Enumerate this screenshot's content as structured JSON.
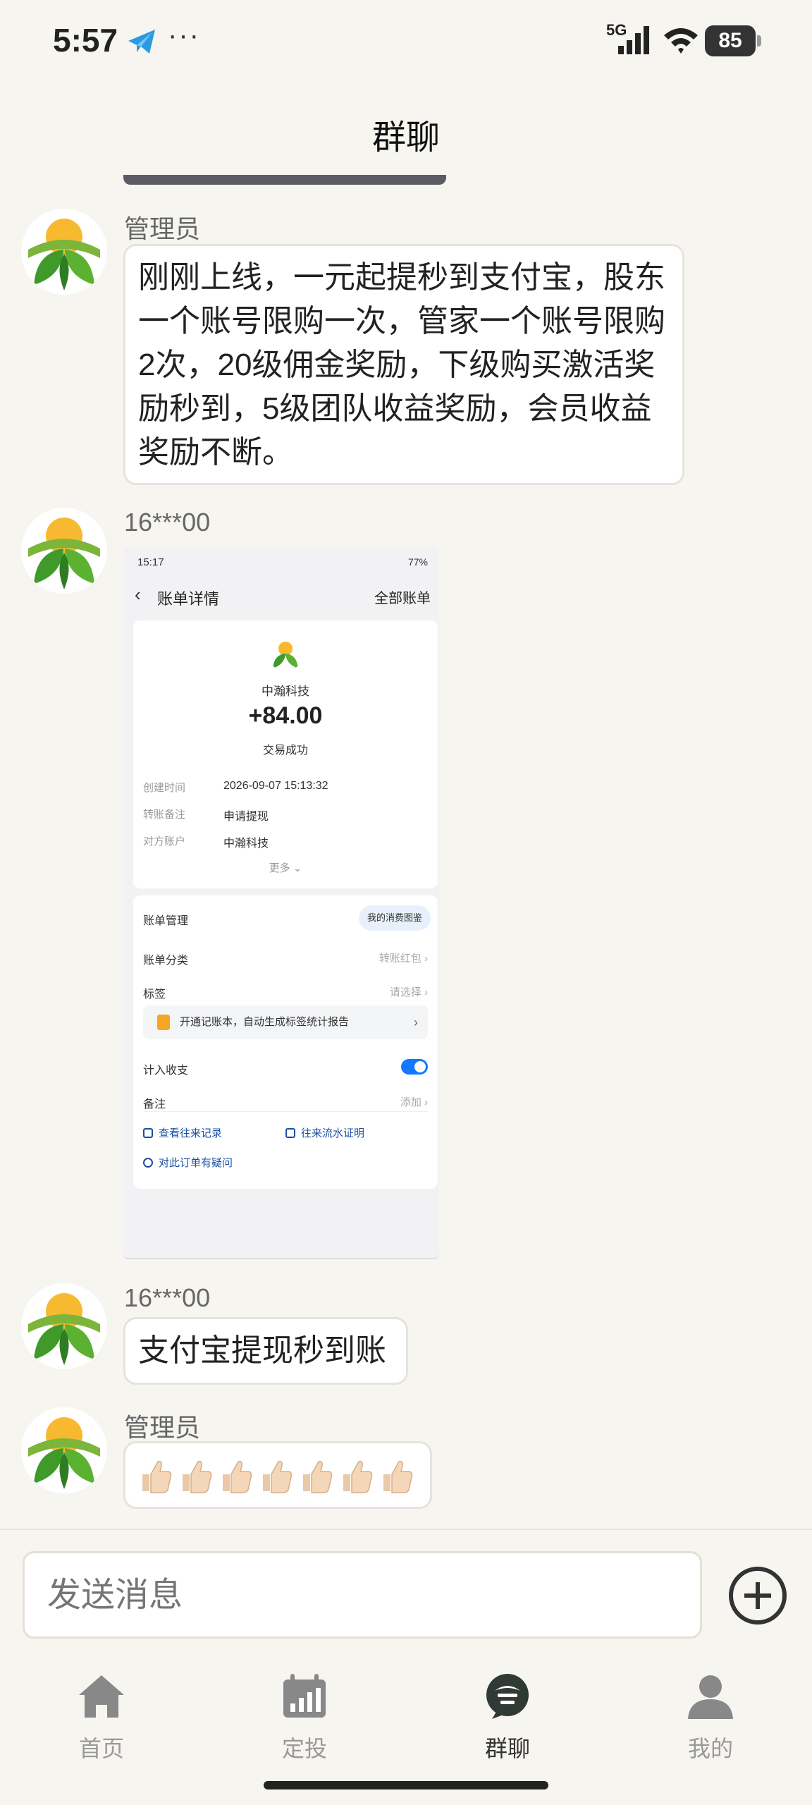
{
  "status_bar": {
    "time": "5:57",
    "more": "···",
    "network": "5G",
    "battery": "85"
  },
  "header": {
    "title": "群聊"
  },
  "messages": [
    {
      "sender": "管理员",
      "text": "刚刚上线，一元起提秒到支付宝，股东一个账号限购一次，管家一个账号限购2次，20级佣金奖励，下级购买激活奖励秒到，5级团队收益奖励，会员收益奖励不断。"
    },
    {
      "sender": "16***00",
      "image": {
        "status_time": "15:17",
        "status_battery": "77%",
        "title": "账单详情",
        "all_bills": "全部账单",
        "merchant": "中瀚科技",
        "amount": "+84.00",
        "status": "交易成功",
        "rows": [
          {
            "label": "创建时间",
            "value": "2026-09-07 15:13:32"
          },
          {
            "label": "转账备注",
            "value": "申请提现"
          },
          {
            "label": "对方账户",
            "value": "中瀚科技"
          }
        ],
        "more": "更多 ⌄",
        "manage": "账单管理",
        "consume_chart": "我的消费图鉴",
        "category_label": "账单分类",
        "category_value": "转账红包 ›",
        "tag_label": "标签",
        "tag_value": "请选择 ›",
        "tip": "开通记账本，自动生成标签统计报告",
        "income_label": "计入收支",
        "note_label": "备注",
        "note_value": "添加 ›",
        "history": "查看往来记录",
        "proof": "往来流水证明",
        "question": "对此订单有疑问"
      }
    },
    {
      "sender": "16***00",
      "text": "支付宝提现秒到账"
    },
    {
      "sender": "管理员",
      "emoji_count": 7
    }
  ],
  "input": {
    "placeholder": "发送消息"
  },
  "tabs": [
    {
      "label": "首页",
      "icon": "home-icon"
    },
    {
      "label": "定投",
      "icon": "calendar-icon"
    },
    {
      "label": "群聊",
      "icon": "chat-icon",
      "active": true
    },
    {
      "label": "我的",
      "icon": "profile-icon"
    }
  ],
  "colors": {
    "background": "#f7f5f0",
    "active_tab": "#333333",
    "inactive_tab": "#999999",
    "switch": "#1677ff"
  }
}
